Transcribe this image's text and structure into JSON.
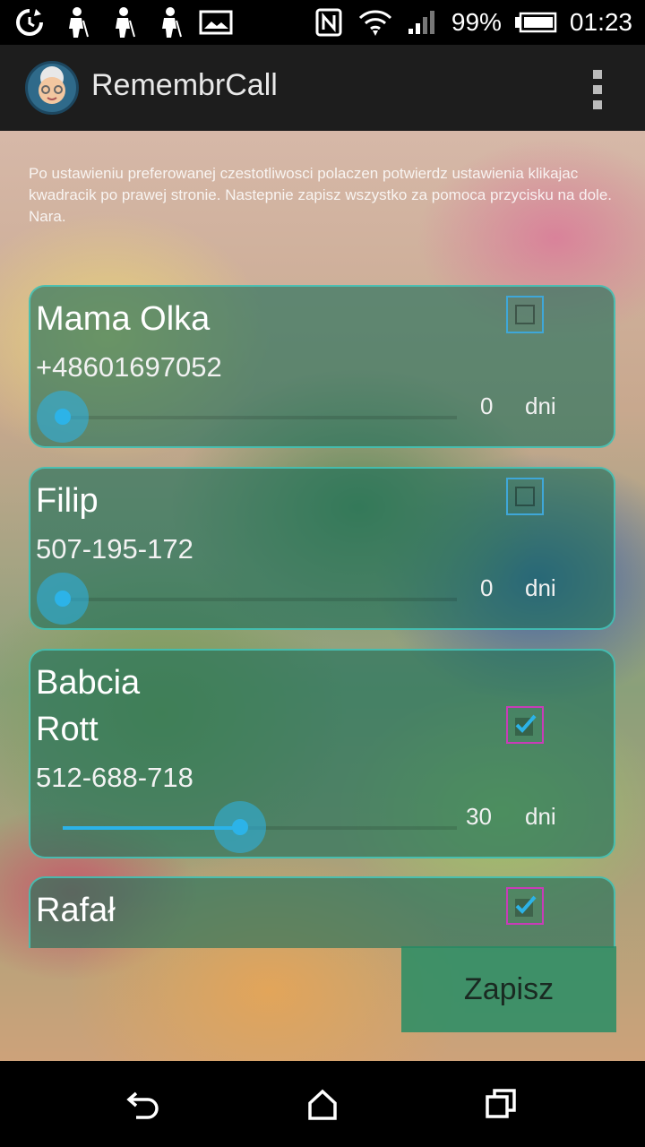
{
  "status_bar": {
    "left_icons": [
      "sync-icon",
      "elder-person-icon",
      "elder-person-icon",
      "elder-person-icon",
      "image-icon"
    ],
    "right_icons": [
      "nfc-icon",
      "wifi-icon",
      "signal-icon"
    ],
    "battery": "99%",
    "time": "01:23"
  },
  "app": {
    "title": "RemembrCall",
    "icon": "grandma-avatar-icon",
    "menu_icon": "overflow-menu-icon"
  },
  "intro_text": "Po ustawieniu preferowanej czestotliwosci polaczen potwierdz ustawienia klikajac kwadracik po prawej stronie. Nastepnie zapisz wszystko za pomoca przycisku na dole. Nara.",
  "contacts": [
    {
      "name": "Mama Olka",
      "phone": "+48601697052",
      "days": "0",
      "unit": "dni",
      "checked": false,
      "slider_fraction": 0
    },
    {
      "name": "Filip",
      "phone": "507-195-172",
      "days": "0",
      "unit": "dni",
      "checked": false,
      "slider_fraction": 0
    },
    {
      "name": "Babcia Rott",
      "name_line1": "Babcia",
      "name_line2": "Rott",
      "phone": "512-688-718",
      "days": "30",
      "unit": "dni",
      "checked": true,
      "slider_fraction": 0.45
    },
    {
      "name": "Rafał",
      "checked": true
    }
  ],
  "save_label": "Zapisz",
  "nav": [
    "back-icon",
    "home-icon",
    "recents-icon"
  ],
  "colors": {
    "accent": "#2cb3e8",
    "card_border": "#46d2c8",
    "checkbox_checked": "#c83cb8"
  }
}
